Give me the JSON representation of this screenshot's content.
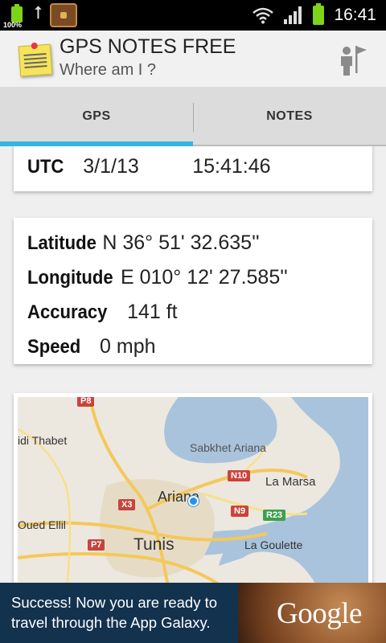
{
  "status_bar": {
    "battery_percent_label": "100%",
    "time": "16:41",
    "icons": [
      "battery-icon",
      "usb-icon",
      "treasure-chest-icon",
      "wifi-icon",
      "signal-icon",
      "battery-icon"
    ],
    "battery_color": "#7fd319"
  },
  "action_bar": {
    "title": "GPS NOTES FREE",
    "subtitle": "Where am I ?",
    "app_icon": "sticky-note-icon",
    "action_icon": "person-flag-icon"
  },
  "tabs": [
    {
      "label": "GPS",
      "selected": true
    },
    {
      "label": "NOTES",
      "selected": false
    }
  ],
  "accent_color": "#33b5e5",
  "utc": {
    "label": "UTC",
    "date": "3/1/13",
    "time": "15:41:46"
  },
  "location": {
    "latitude_label": "Latitude",
    "latitude_value": "N 36° 51' 32.635''",
    "longitude_label": "Longitude",
    "longitude_value": "E 010° 12' 27.585''",
    "accuracy_label": "Accuracy",
    "accuracy_value": "141 ft",
    "speed_label": "Speed",
    "speed_value": "0 mph"
  },
  "map": {
    "places": [
      "idi Thabet",
      "Sabkhet Ariana",
      "La Marsa",
      "Ariana",
      "Oued Ellil",
      "Tunis",
      "La Goulette"
    ],
    "roads": [
      "P8",
      "N10",
      "X3",
      "N9",
      "R23",
      "P7"
    ]
  },
  "ad": {
    "line1": "Success! Now you are ready to",
    "line2": "travel through the App Galaxy.",
    "logo": "Google"
  }
}
